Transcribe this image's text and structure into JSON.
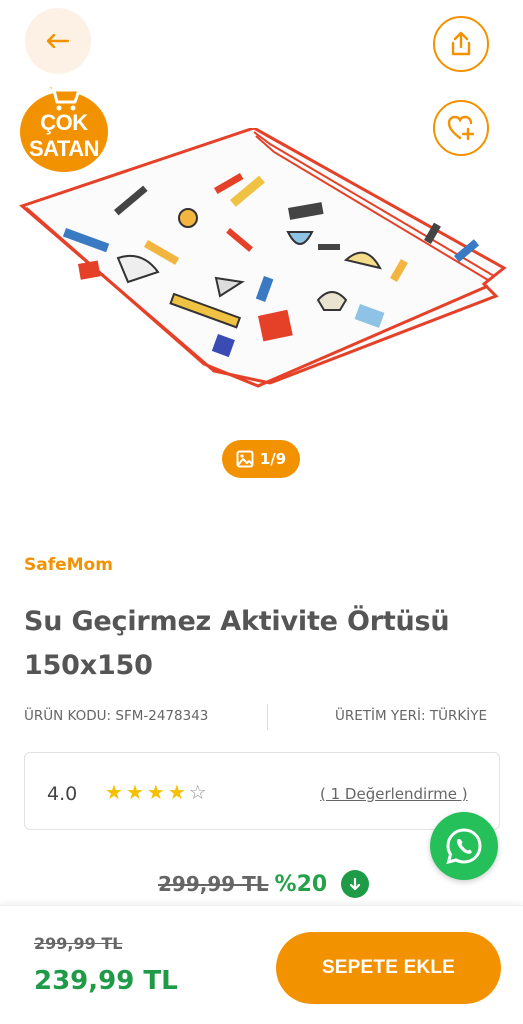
{
  "header": {
    "back_icon": "arrow-left-icon",
    "share_icon": "share-icon",
    "favorite_icon": "heart-plus-icon"
  },
  "badge": {
    "line1": "ÇOK",
    "line2": "SATAN",
    "icon": "shopping-cart-icon",
    "color": "#f39200"
  },
  "gallery": {
    "counter": "1/9",
    "icon": "image-icon"
  },
  "product": {
    "brand": "SafeMom",
    "title_line1": "Su Geçirmez Aktivite Örtüsü",
    "title_line2": "150x150",
    "code_text": "ÜRÜN KODU: SFM-2478343",
    "origin_text": "ÜRETİM YERİ: TÜRKİYE"
  },
  "rating": {
    "value": "4.0",
    "stars_filled": 4,
    "stars_total": 5,
    "reviews_text": "( 1 Değerlendirme )"
  },
  "pricing": {
    "old_price": "299,99 TL",
    "discount": "%20",
    "new_price": "239,99 TL"
  },
  "actions": {
    "add_to_cart": "SEPETE EKLE",
    "whatsapp_icon": "whatsapp-icon"
  },
  "colors": {
    "accent": "#f39200",
    "green": "#1f9a46",
    "whatsapp": "#25c05a"
  }
}
